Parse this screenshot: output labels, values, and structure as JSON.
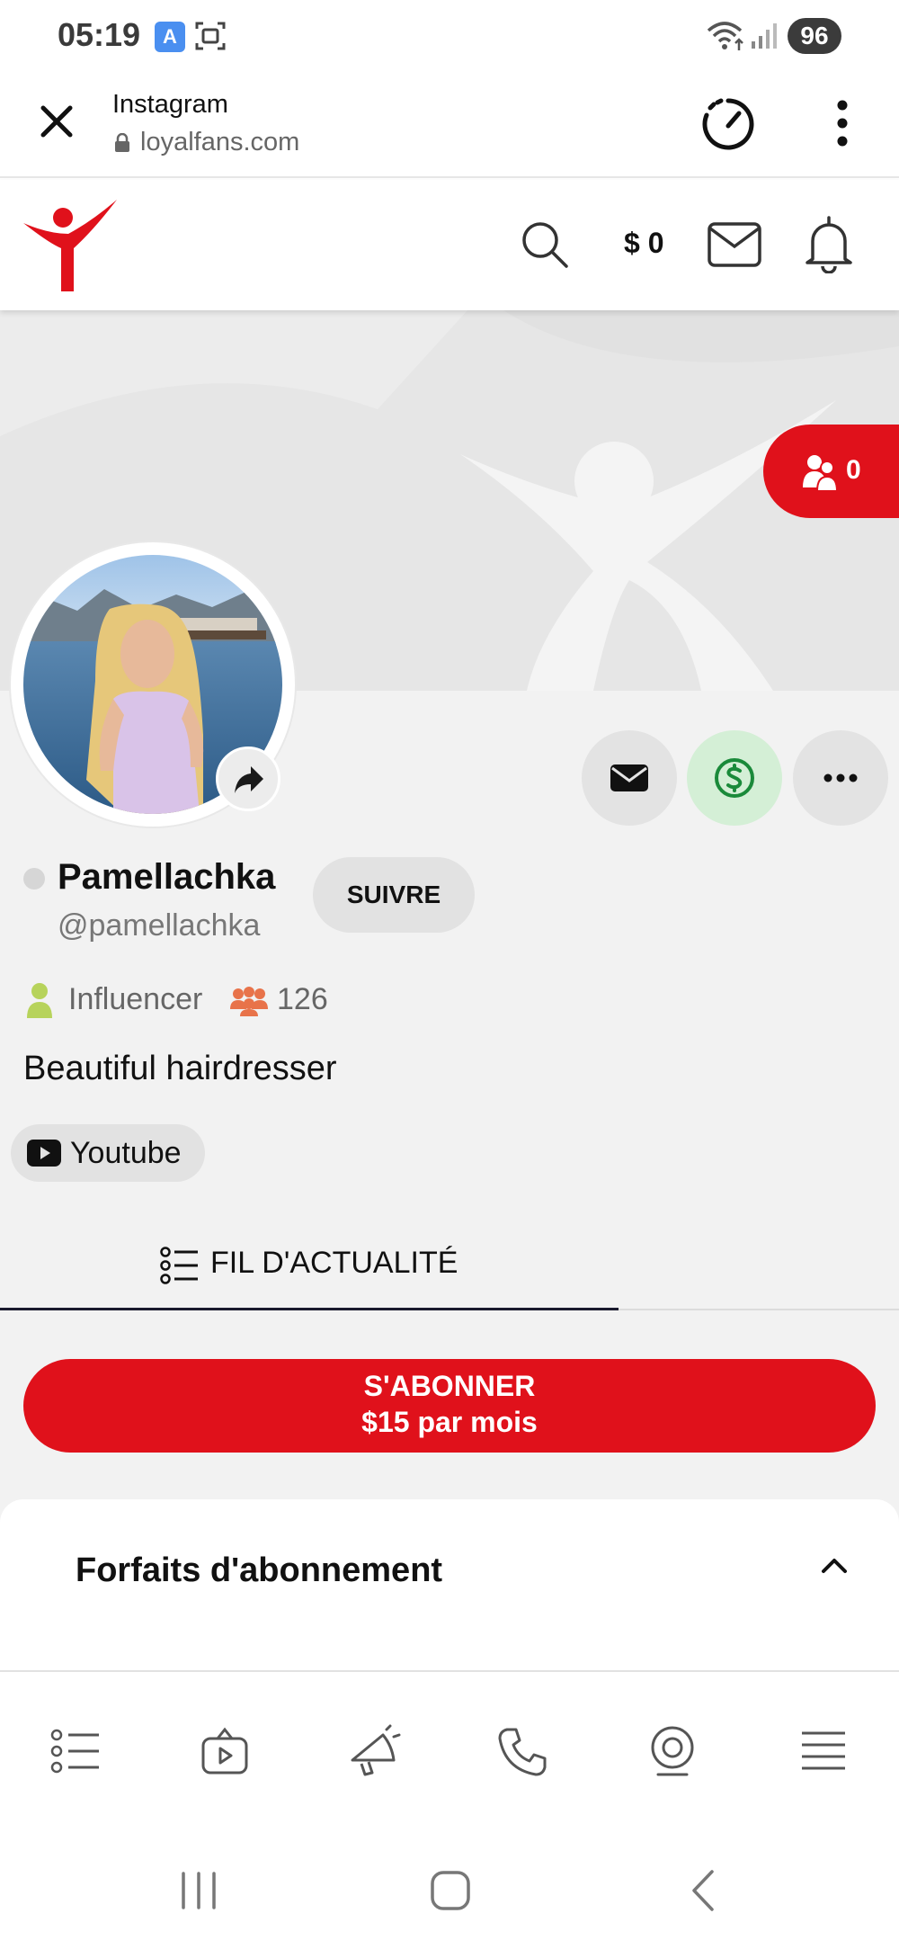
{
  "status_bar": {
    "time": "05:19",
    "app_icon_letter": "A",
    "battery": "96"
  },
  "browser": {
    "title": "Instagram",
    "url": "loyalfans.com"
  },
  "header": {
    "wallet": "$ 0"
  },
  "profile": {
    "subscribers_count": "0",
    "display_name": "Pamellachka",
    "username": "@pamellachka",
    "follow_label": "SUIVRE",
    "role": "Influencer",
    "fans_count": "126",
    "bio": "Beautiful hairdresser",
    "social_link": "Youtube"
  },
  "tabs": {
    "feed_label": "FIL D'ACTUALITÉ"
  },
  "subscribe": {
    "line1": "S'ABONNER",
    "line2": "$15 par mois"
  },
  "plans": {
    "title": "Forfaits d'abonnement"
  },
  "colors": {
    "brand_red": "#e0111b",
    "tip_green": "#1a8a3a",
    "tip_bg": "#d4efd6"
  },
  "icons": {
    "app_nav": [
      "feed-icon",
      "video-icon",
      "megaphone-icon",
      "phone-icon",
      "webcam-icon",
      "menu-icon"
    ]
  }
}
